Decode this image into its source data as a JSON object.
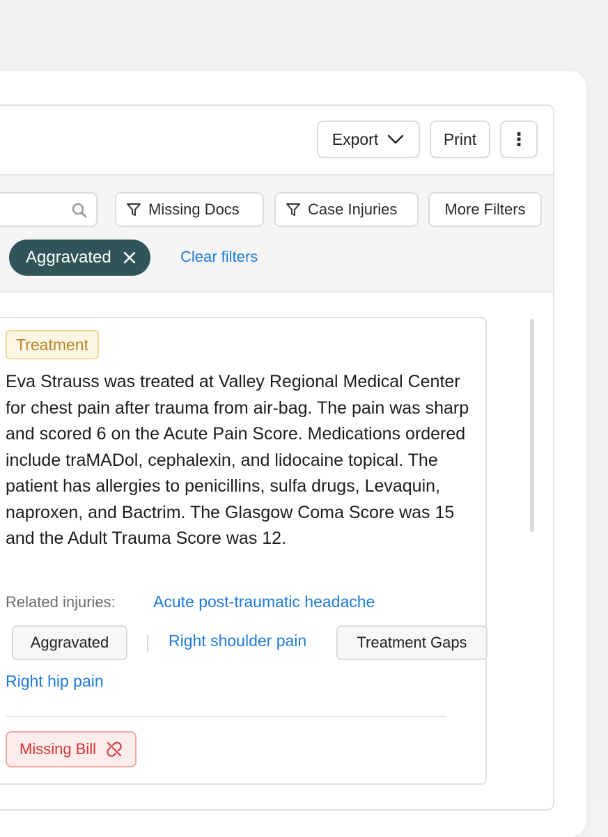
{
  "toolbar": {
    "export_label": "Export",
    "print_label": "Print",
    "more_label": "⋮"
  },
  "filters": {
    "search_placeholder": "",
    "missing_docs": "Missing Docs",
    "case_injuries": "Case Injuries",
    "more_filters": "More Filters",
    "active_chip": "Aggravated",
    "clear_filters": "Clear filters"
  },
  "card": {
    "tag": "Treatment",
    "summary": "Eva Strauss was treated at Valley Regional Medical Center for chest pain after trauma from air-bag. The pain was sharp and scored 6 on the Acute Pain Score. Medications ordered include traMADol, cephalexin, and lidocaine topical. The patient has allergies to penicillins, sulfa drugs, Levaquin, naproxen, and Bactrim. The Glasgow Coma Score was 15 and the Adult Trauma Score was 12.",
    "related_label": "Related injuries:",
    "related": {
      "headache": "Acute post-traumatic headache",
      "aggravated": "Aggravated",
      "shoulder": "Right shoulder pain",
      "gaps": "Treatment Gaps",
      "hip": "Right hip pain"
    },
    "missing_bill": "Missing Bill"
  },
  "colors": {
    "chip_bg": "#2f5559",
    "link": "#1e7ad9",
    "treatment_tag": "#b7862a",
    "missing_red": "#d63333"
  }
}
